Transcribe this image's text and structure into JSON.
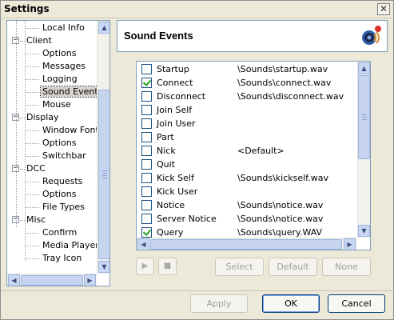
{
  "window": {
    "title": "Settings",
    "close_glyph": "✕"
  },
  "tree": {
    "items": [
      {
        "label": "Local Info"
      },
      {
        "label": "Client",
        "expander": "−"
      },
      {
        "label": "Options"
      },
      {
        "label": "Messages"
      },
      {
        "label": "Logging"
      },
      {
        "label": "Sound Events",
        "selected": true
      },
      {
        "label": "Mouse"
      },
      {
        "label": "Display",
        "expander": "−"
      },
      {
        "label": "Window Fonts"
      },
      {
        "label": "Options"
      },
      {
        "label": "Switchbar"
      },
      {
        "label": "DCC",
        "expander": "−"
      },
      {
        "label": "Requests"
      },
      {
        "label": "Options"
      },
      {
        "label": "File Types"
      },
      {
        "label": "Misc",
        "expander": "−"
      },
      {
        "label": "Confirm"
      },
      {
        "label": "Media Player"
      },
      {
        "label": "Tray Icon"
      }
    ]
  },
  "header": {
    "title": "Sound Events",
    "icon": "speaker-sound-icon"
  },
  "events": [
    {
      "name": "Startup",
      "file": "\\Sounds\\startup.wav",
      "checked": false
    },
    {
      "name": "Connect",
      "file": "\\Sounds\\connect.wav",
      "checked": true
    },
    {
      "name": "Disconnect",
      "file": "\\Sounds\\disconnect.wav",
      "checked": false
    },
    {
      "name": "Join Self",
      "file": "",
      "checked": false
    },
    {
      "name": "Join User",
      "file": "",
      "checked": false
    },
    {
      "name": "Part",
      "file": "",
      "checked": false
    },
    {
      "name": "Nick",
      "file": "<Default>",
      "checked": false
    },
    {
      "name": "Quit",
      "file": "",
      "checked": false
    },
    {
      "name": "Kick Self",
      "file": "\\Sounds\\kickself.wav",
      "checked": false
    },
    {
      "name": "Kick User",
      "file": "",
      "checked": false
    },
    {
      "name": "Notice",
      "file": "\\Sounds\\notice.wav",
      "checked": false
    },
    {
      "name": "Server Notice",
      "file": "\\Sounds\\notice.wav",
      "checked": false
    },
    {
      "name": "Query",
      "file": "\\Sounds\\query.WAV",
      "checked": true
    }
  ],
  "controls": {
    "play_glyph": "▶",
    "stop_glyph": "■",
    "select_label": "Select",
    "default_label": "Default",
    "none_label": "None"
  },
  "footer": {
    "apply_label": "Apply",
    "ok_label": "OK",
    "cancel_label": "Cancel"
  },
  "scroll_glyphs": {
    "up": "▲",
    "down": "▼",
    "left": "◀",
    "right": "▶"
  }
}
